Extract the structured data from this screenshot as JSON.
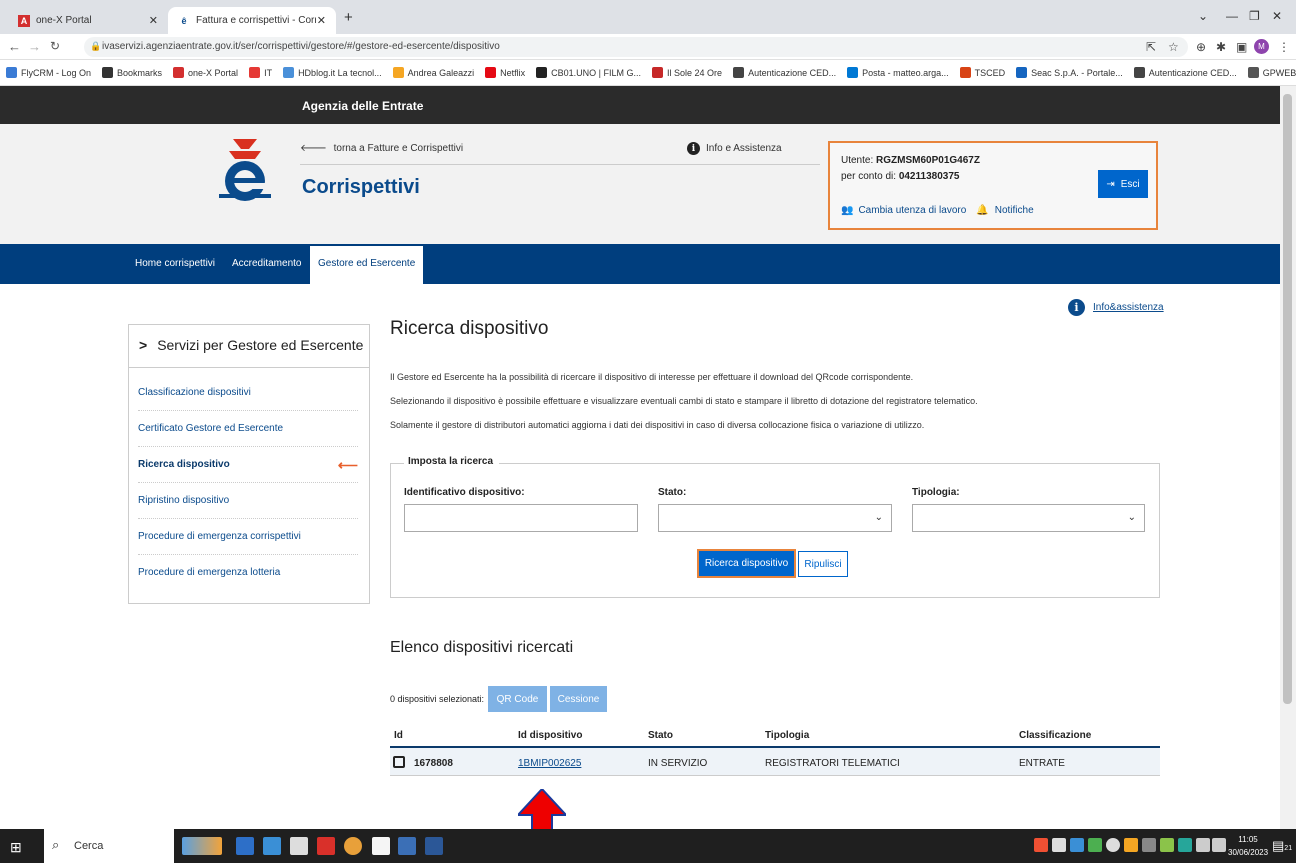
{
  "browser": {
    "tabs": [
      {
        "title": "one-X Portal",
        "icon": "onex-icon"
      },
      {
        "title": "Fattura e corrispettivi - Corrispett",
        "icon": "agenzia-icon"
      }
    ],
    "url": "ivaservizi.agenziaentrate.gov.it/ser/corrispettivi/gestore/#/gestore-ed-esercente/dispositivo",
    "profile_initial": "M",
    "bookmarks": [
      {
        "label": "FlyCRM - Log On",
        "color": "#3a7bd5"
      },
      {
        "label": "Bookmarks",
        "color": "#333333"
      },
      {
        "label": "one-X Portal",
        "color": "#d32f2f"
      },
      {
        "label": "IT",
        "color": "#e53935"
      },
      {
        "label": "HDblog.it La tecnol...",
        "color": "#4a90d9"
      },
      {
        "label": "Andrea Galeazzi",
        "color": "#f5a623"
      },
      {
        "label": "Netflix",
        "color": "#e50914"
      },
      {
        "label": "CB01.UNO | FILM G...",
        "color": "#222222"
      },
      {
        "label": "Il Sole 24 Ore",
        "color": "#c62828"
      },
      {
        "label": "Autenticazione CED...",
        "color": "#444444"
      },
      {
        "label": "Posta - matteo.arga...",
        "color": "#0078d4"
      },
      {
        "label": "TSCED",
        "color": "#d84315"
      },
      {
        "label": "Seac S.p.A. - Portale...",
        "color": "#1565c0"
      },
      {
        "label": "Autenticazione CED...",
        "color": "#444444"
      },
      {
        "label": "GPWEB",
        "color": "#555555"
      }
    ]
  },
  "agency": "Agenzia delle Entrate",
  "header": {
    "back_link": "torna a Fatture e Corrispettivi",
    "title": "Corrispettivi",
    "info": "Info e Assistenza"
  },
  "user": {
    "utente_label": "Utente: ",
    "utente": "RGZMSM60P01G467Z",
    "conto_label": "per conto di: ",
    "conto": "04211380375",
    "cambia": "Cambia utenza di lavoro",
    "notifiche": "Notifiche",
    "esci": "Esci"
  },
  "nav": [
    "Home corrispettivi",
    "Accreditamento",
    "Gestore ed Esercente"
  ],
  "info_right": "Info&assistenza",
  "sidebar": {
    "title": "Servizi per Gestore ed Esercente",
    "items": [
      "Classificazione dispositivi",
      "Certificato Gestore ed Esercente",
      "Ricerca dispositivo",
      "Ripristino dispositivo",
      "Procedure di emergenza corrispettivi",
      "Procedure di emergenza lotteria"
    ]
  },
  "main": {
    "title": "Ricerca dispositivo",
    "desc": [
      "Il Gestore ed Esercente ha la possibilità di ricercare il dispositivo di interesse per effettuare il download del QRcode corrispondente.",
      "Selezionando il dispositivo è possibile effettuare e visualizzare eventuali cambi di stato e stampare il libretto di dotazione del registratore telematico.",
      "Solamente il gestore di distributori automatici aggiorna i dati dei dispositivi in caso di diversa collocazione fisica o variazione di utilizzo."
    ],
    "legend": "Imposta la ricerca",
    "fields": [
      "Identificativo dispositivo:",
      "Stato:",
      "Tipologia:"
    ],
    "btn_search": "Ricerca dispositivo",
    "btn_clear": "Ripulisci",
    "list_title": "Elenco dispositivi ricercati",
    "selected": "0 dispositivi selezionati:",
    "btn_qr": "QR Code",
    "btn_cessione": "Cessione",
    "columns": [
      "Id",
      "Id dispositivo",
      "Stato",
      "Tipologia",
      "Classificazione"
    ],
    "row": {
      "id": "1678808",
      "device": "1BMIP002625",
      "stato": "IN SERVIZIO",
      "tipologia": "REGISTRATORI TELEMATICI",
      "classificazione": "ENTRATE"
    }
  },
  "taskbar": {
    "search": "Cerca",
    "time": "11:05",
    "date": "30/06/2023",
    "notif_count": "21"
  }
}
